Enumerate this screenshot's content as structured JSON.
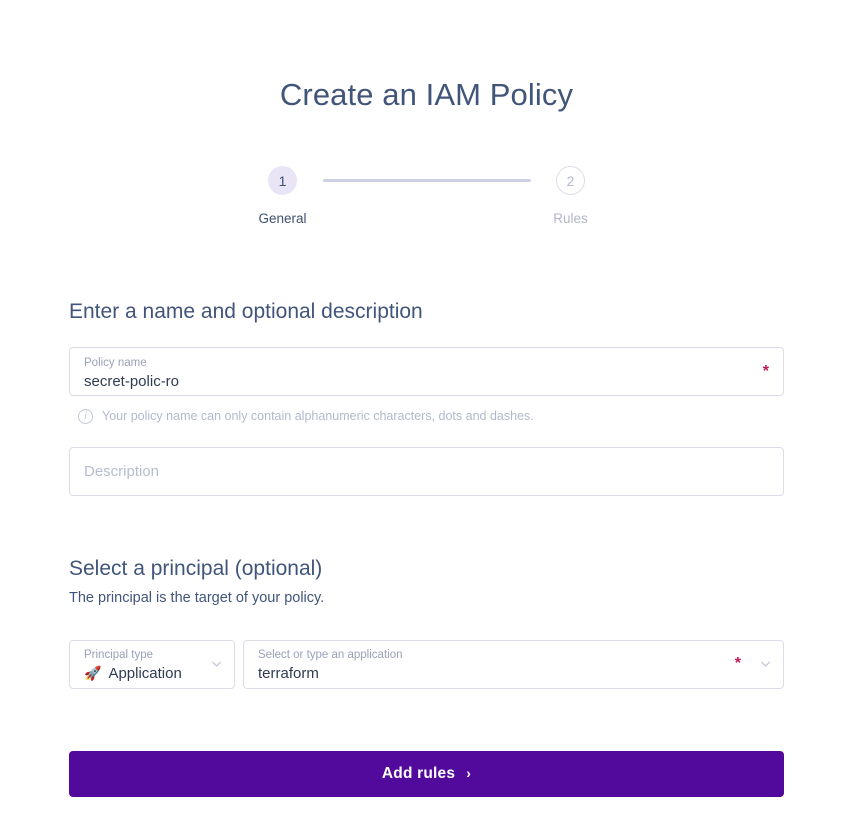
{
  "page": {
    "title": "Create an IAM Policy"
  },
  "stepper": {
    "steps": [
      {
        "number": "1",
        "label": "General",
        "state": "active"
      },
      {
        "number": "2",
        "label": "Rules",
        "state": "inactive"
      }
    ]
  },
  "name_section": {
    "heading": "Enter a name and optional description",
    "policy_name": {
      "label": "Policy name",
      "value": "secret-polic-ro",
      "required_marker": "*"
    },
    "helper": {
      "icon": "info-circle-icon",
      "text": "Your policy name can only contain alphanumeric characters, dots and dashes."
    },
    "description": {
      "placeholder": "Description",
      "value": ""
    }
  },
  "principal_section": {
    "heading": "Select a principal (optional)",
    "subtitle": "The principal is the target of your policy.",
    "principal_type": {
      "label": "Principal type",
      "value": "Application",
      "icon": "rocket-icon",
      "chevron": "chevron-down-icon"
    },
    "application": {
      "label": "Select or type an application",
      "value": "terraform",
      "required_marker": "*",
      "chevron": "chevron-down-icon"
    }
  },
  "footer": {
    "submit_label": "Add rules",
    "submit_chevron": "›"
  },
  "colors": {
    "accent_purple": "#520a9c",
    "title_slate": "#41557a",
    "required_red": "#c2185b",
    "step_active_fill": "#eae4f7",
    "border_light": "#dcdde8"
  }
}
